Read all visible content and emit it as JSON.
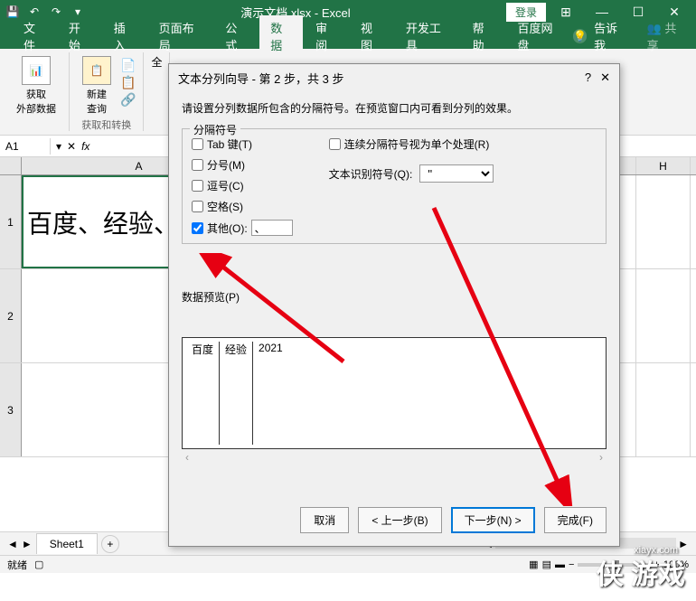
{
  "title": {
    "filename": "演示文档.xlsx",
    "app": "Excel",
    "login": "登录"
  },
  "tabs": {
    "file": "文件",
    "home": "开始",
    "insert": "插入",
    "layout": "页面布局",
    "formula": "公式",
    "data": "数据",
    "review": "审阅",
    "view": "视图",
    "dev": "开发工具",
    "help": "帮助",
    "baidu": "百度网盘",
    "tell": "告诉我",
    "share": "共享"
  },
  "ribbon": {
    "external": "获取\n外部数据",
    "newquery": "新建\n查询",
    "all": "全",
    "group1": "获取和转换"
  },
  "namebox": "A1",
  "colheaders": {
    "a": "A",
    "h": "H"
  },
  "rows": {
    "r1": "1",
    "r2": "2",
    "r3": "3"
  },
  "cell_a1": "百度、经验、",
  "dialog": {
    "title": "文本分列向导 - 第 2 步，共 3 步",
    "instr": "请设置分列数据所包含的分隔符号。在预览窗口内可看到分列的效果。",
    "fs_title": "分隔符号",
    "tab": "Tab 键(T)",
    "semi": "分号(M)",
    "comma": "逗号(C)",
    "space": "空格(S)",
    "other": "其他(O):",
    "other_val": "、",
    "consec": "连续分隔符号视为单个处理(R)",
    "qual_label": "文本识别符号(Q):",
    "qual_val": "\"",
    "preview_label": "数据预览(P)",
    "prev1": "百度",
    "prev2": "经验",
    "prev3": "2021",
    "cancel": "取消",
    "back": "< 上一步(B)",
    "next": "下一步(N) >",
    "finish": "完成(F)"
  },
  "sheet": {
    "tab1": "Sheet1",
    "nav_prev": "◄",
    "nav_next": "►"
  },
  "status": {
    "ready": "就绪",
    "zoom": "100%"
  },
  "watermark": {
    "main": "侠 游戏",
    "sub": "xiayx.com"
  }
}
